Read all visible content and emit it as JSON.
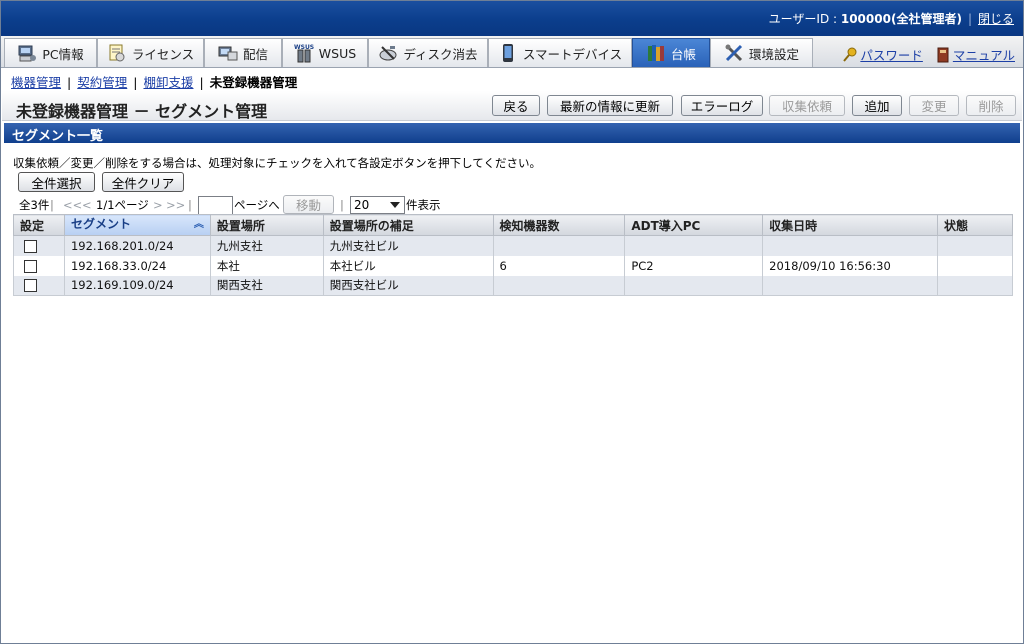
{
  "header": {
    "user_label": "ユーザーID : ",
    "user_id": "100000(全社管理者)",
    "close": "閉じる"
  },
  "tabs": [
    {
      "label": "PC情報",
      "icon": "pc-info-icon"
    },
    {
      "label": "ライセンス",
      "icon": "license-icon"
    },
    {
      "label": "配信",
      "icon": "distribution-icon"
    },
    {
      "label": "WSUS",
      "icon": "wsus-icon"
    },
    {
      "label": "ディスク消去",
      "icon": "disk-erase-icon"
    },
    {
      "label": "スマートデバイス",
      "icon": "smart-device-icon"
    },
    {
      "label": "台帳",
      "icon": "ledger-icon",
      "active": true
    },
    {
      "label": "環境設定",
      "icon": "settings-tools-icon"
    }
  ],
  "top_links": {
    "password": "パスワード",
    "manual": "マニュアル"
  },
  "breadcrumb": {
    "items": [
      "機器管理",
      "契約管理",
      "棚卸支援"
    ],
    "current": "未登録機器管理"
  },
  "page": {
    "title": "未登録機器管理 － セグメント管理",
    "buttons": {
      "back": "戻る",
      "refresh": "最新の情報に更新",
      "error_log": "エラーログ",
      "collect": "収集依頼",
      "add": "追加",
      "change": "変更",
      "delete": "削除"
    }
  },
  "section": {
    "title": "セグメント一覧",
    "instruction": "収集依頼／変更／削除をする場合は、処理対象にチェックを入れて各設定ボタンを押下してください。",
    "select_all": "全件選択",
    "clear_all": "全件クリア"
  },
  "pager": {
    "total": "全3件",
    "first": "<<",
    "prev": "<",
    "page_info": "1/1ページ",
    "next": ">",
    "last": ">>",
    "page_input_value": "",
    "page_suffix": "ページへ",
    "move": "移動",
    "per_page": "20",
    "per_page_suffix": "件表示"
  },
  "table": {
    "columns": [
      "設定",
      "セグメント",
      "設置場所",
      "設置場所の補足",
      "検知機器数",
      "ADT導入PC",
      "収集日時",
      "状態"
    ],
    "rows": [
      [
        "",
        "192.168.201.0/24",
        "九州支社",
        "九州支社ビル",
        "",
        "",
        "",
        ""
      ],
      [
        "",
        "192.168.33.0/24",
        "本社",
        "本社ビル",
        "6",
        "PC2",
        "2018/09/10 16:56:30",
        ""
      ],
      [
        "",
        "192.169.109.0/24",
        "関西支社",
        "関西支社ビル",
        "",
        "",
        "",
        ""
      ]
    ]
  }
}
